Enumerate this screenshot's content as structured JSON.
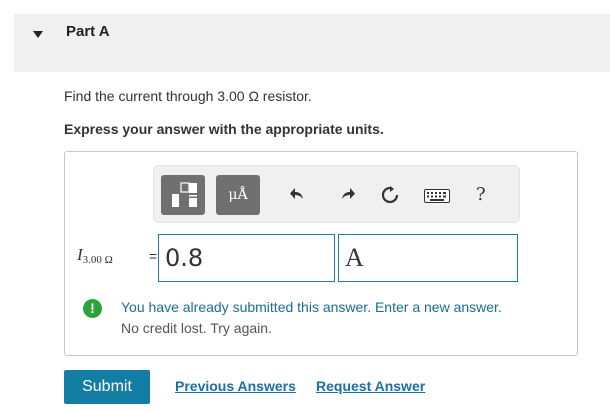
{
  "part": {
    "title": "Part A",
    "collapse_icon": "caret-down-icon"
  },
  "question": {
    "text": "Find the current through 3.00 Ω resistor.",
    "instruction": "Express your answer with the appropriate units."
  },
  "toolbar": {
    "templates_icon": "templates-icon",
    "units_glyph": "μÅ",
    "undo_icon": "undo-icon",
    "redo_icon": "redo-icon",
    "reset_icon": "reset-icon",
    "keyboard_icon": "keyboard-icon",
    "help_label": "?"
  },
  "answer": {
    "variable": "I",
    "variable_subscript": "3.00 Ω",
    "equals": "=",
    "value": "0.8",
    "unit": "A"
  },
  "feedback": {
    "icon": "exclamation-icon",
    "line1": "You have already submitted this answer. Enter a new answer.",
    "line2": "No credit lost. Try again.",
    "color": "#1a6f8e",
    "icon_color": "#2ca33a"
  },
  "actions": {
    "submit_label": "Submit",
    "previous_answers_label": "Previous Answers",
    "request_answer_label": "Request Answer"
  },
  "colors": {
    "accent": "#137da4",
    "input_border": "#1a8294"
  }
}
